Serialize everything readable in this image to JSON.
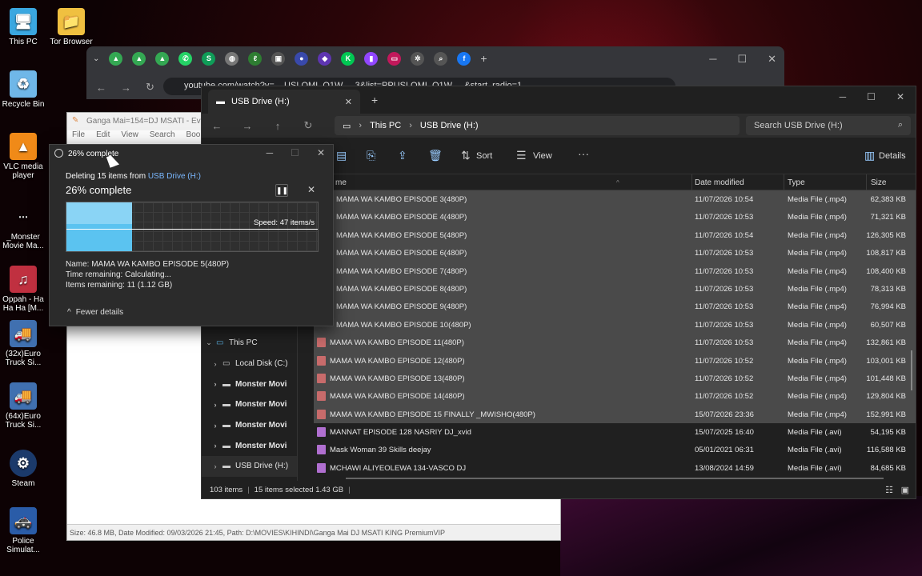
{
  "desktop": {
    "icons": [
      {
        "label": "This PC"
      },
      {
        "label": "Tor Browser"
      },
      {
        "label": "Recycle Bin"
      },
      {
        "label": "VLC media player"
      },
      {
        "label": "_Monster Movie Ma..."
      },
      {
        "label": "Oppah - Ha Ha Ha [M..."
      },
      {
        "label": "(32x)Euro Truck Si..."
      },
      {
        "label": "(64x)Euro Truck Si..."
      },
      {
        "label": "Steam"
      },
      {
        "label": "Police Simulat..."
      }
    ]
  },
  "browser": {
    "address_text": "youtube.com/watch?v=... USLOMI_O1W ... 3&list=PPUSLOMI_O1W ... &start_radio=1"
  },
  "notepad": {
    "title": "Ganga Mai=154=DJ MSATI - Ever",
    "menu": [
      "File",
      "Edit",
      "View",
      "Search",
      "Bookmar"
    ],
    "status": "Size: 46.8 MB, Date Modified: 09/03/2026 21:45, Path: D:\\MOVIES\\KIHINDI\\Ganga Mai DJ MSATI KING PremiumVIP"
  },
  "explorer": {
    "tab_title": "USB Drive (H:)",
    "breadcrumb": [
      "This PC",
      "USB Drive (H:)"
    ],
    "search_placeholder": "Search USB Drive (H:)",
    "toolbar": {
      "sort": "Sort",
      "view": "View",
      "details": "Details"
    },
    "columns": {
      "name": "me",
      "date": "Date modified",
      "type": "Type",
      "size": "Size"
    },
    "nav": [
      {
        "label": "This PC",
        "level": 0
      },
      {
        "label": "Local Disk (C:)",
        "level": 1
      },
      {
        "label": "Monster Movi",
        "level": 1
      },
      {
        "label": "Monster Movi",
        "level": 1
      },
      {
        "label": "Monster Movi",
        "level": 1
      },
      {
        "label": "Monster Movi",
        "level": 1
      },
      {
        "label": "USB Drive (H:)",
        "level": 1
      }
    ],
    "files": [
      {
        "name": "MAMA WA KAMBO EPISODE 3(480P)",
        "date": "11/07/2026 10:54",
        "type": "Media File (.mp4)",
        "size": "62,383 KB",
        "selected": true,
        "icon": false
      },
      {
        "name": "MAMA WA KAMBO EPISODE 4(480P)",
        "date": "11/07/2026 10:53",
        "type": "Media File (.mp4)",
        "size": "71,321 KB",
        "selected": true,
        "icon": false
      },
      {
        "name": "MAMA WA KAMBO EPISODE 5(480P)",
        "date": "11/07/2026 10:54",
        "type": "Media File (.mp4)",
        "size": "126,305 KB",
        "selected": true,
        "icon": false
      },
      {
        "name": "MAMA WA KAMBO EPISODE 6(480P)",
        "date": "11/07/2026 10:53",
        "type": "Media File (.mp4)",
        "size": "108,817 KB",
        "selected": true,
        "icon": false
      },
      {
        "name": "MAMA WA KAMBO EPISODE 7(480P)",
        "date": "11/07/2026 10:53",
        "type": "Media File (.mp4)",
        "size": "108,400 KB",
        "selected": true,
        "icon": false
      },
      {
        "name": "MAMA WA KAMBO EPISODE 8(480P)",
        "date": "11/07/2026 10:53",
        "type": "Media File (.mp4)",
        "size": "78,313 KB",
        "selected": true,
        "icon": false
      },
      {
        "name": "MAMA WA KAMBO EPISODE 9(480P)",
        "date": "11/07/2026 10:53",
        "type": "Media File (.mp4)",
        "size": "76,994 KB",
        "selected": true,
        "icon": false
      },
      {
        "name": "MAMA WA KAMBO EPISODE 10(480P)",
        "date": "11/07/2026 10:53",
        "type": "Media File (.mp4)",
        "size": "60,507 KB",
        "selected": true,
        "icon": false
      },
      {
        "name": "MAMA WA KAMBO EPISODE 11(480P)",
        "date": "11/07/2026 10:53",
        "type": "Media File (.mp4)",
        "size": "132,861 KB",
        "selected": true,
        "icon": true
      },
      {
        "name": "MAMA WA KAMBO EPISODE 12(480P)",
        "date": "11/07/2026 10:52",
        "type": "Media File (.mp4)",
        "size": "103,001 KB",
        "selected": true,
        "icon": true
      },
      {
        "name": "MAMA WA KAMBO EPISODE 13(480P)",
        "date": "11/07/2026 10:52",
        "type": "Media File (.mp4)",
        "size": "101,448 KB",
        "selected": true,
        "icon": true
      },
      {
        "name": "MAMA WA KAMBO EPISODE 14(480P)",
        "date": "11/07/2026 10:52",
        "type": "Media File (.mp4)",
        "size": "129,804 KB",
        "selected": true,
        "icon": true
      },
      {
        "name": "MAMA WA KAMBO EPISODE 15 FINALLY _MWISHO(480P)",
        "date": "15/07/2026 23:36",
        "type": "Media File (.mp4)",
        "size": "152,991 KB",
        "selected": true,
        "icon": true
      },
      {
        "name": "MANNAT EPISODE 128 NASRIY DJ_xvid",
        "date": "15/07/2025 16:40",
        "type": "Media File (.avi)",
        "size": "54,195 KB",
        "selected": false,
        "icon": true
      },
      {
        "name": "Mask Woman 39 Skills deejay",
        "date": "05/01/2021 06:31",
        "type": "Media File (.avi)",
        "size": "116,588 KB",
        "selected": false,
        "icon": true
      },
      {
        "name": "MCHAWI ALIYEOLEWA 134-VASCO DJ",
        "date": "13/08/2024 14:59",
        "type": "Media File (.avi)",
        "size": "84,685 KB",
        "selected": false,
        "icon": true
      }
    ],
    "status": {
      "items": "103 items",
      "selected": "15 items selected  1.43 GB"
    }
  },
  "progress_dialog": {
    "title": "26% complete",
    "line1_prefix": "Deleting 15 items from ",
    "line1_target": "USB Drive (H:)",
    "headline": "26% complete",
    "speed": "Speed: 47 items/s",
    "progress_fraction": 0.26,
    "name_line": "Name:  MAMA WA KAMBO EPISODE 5(480P)",
    "time_line": "Time remaining:  Calculating...",
    "items_line": "Items remaining:  11 (1.12 GB)",
    "fewer_details": "Fewer details"
  }
}
